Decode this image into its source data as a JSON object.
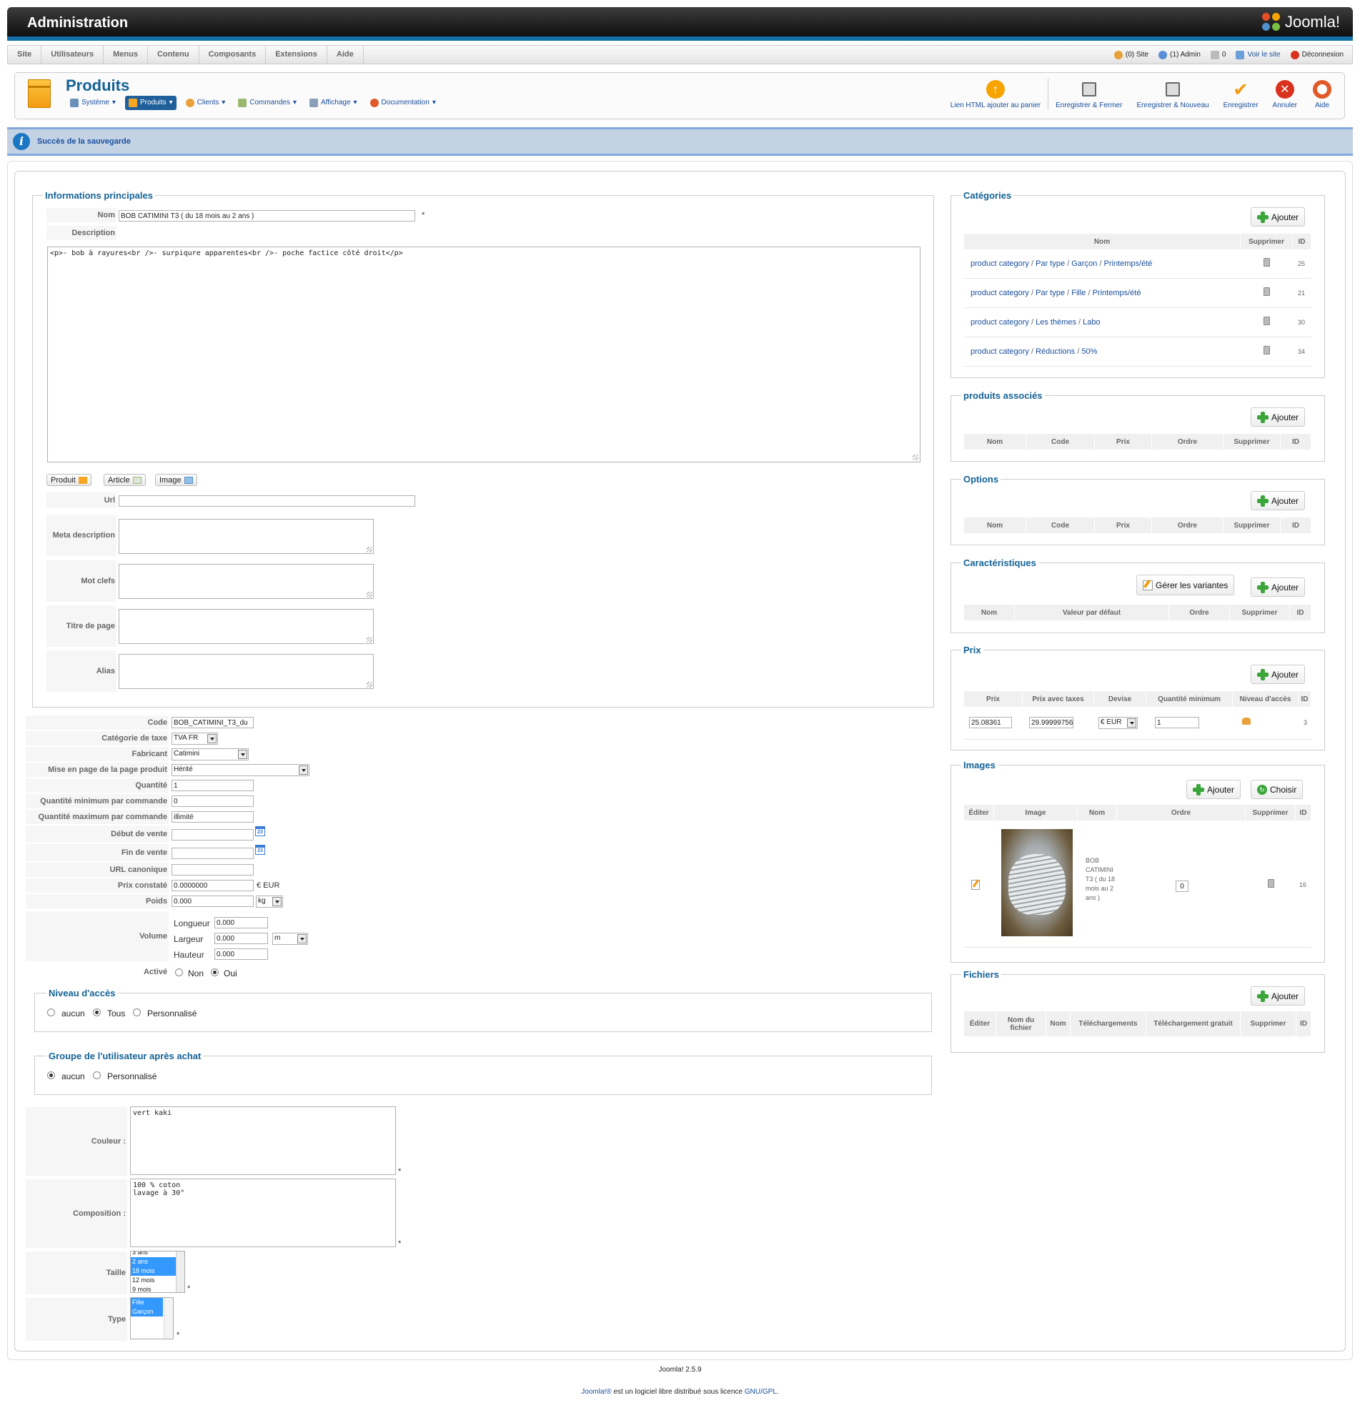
{
  "header": {
    "title": "Administration",
    "brand": "Joomla!"
  },
  "menu": [
    "Site",
    "Utilisateurs",
    "Menus",
    "Contenu",
    "Composants",
    "Extensions",
    "Aide"
  ],
  "status": {
    "site": "(0) Site",
    "admin": "(1) Admin",
    "messages": "0",
    "view_site": "Voir le site",
    "logout": "Déconnexion"
  },
  "toolbar": {
    "title": "Produits",
    "submenu": [
      "Système",
      "Produits",
      "Clients",
      "Commandes",
      "Affichage",
      "Documentation"
    ],
    "buttons": [
      "Lien HTML ajouter au panier",
      "Enregistrer & Fermer",
      "Enregistrer & Nouveau",
      "Enregistrer",
      "Annuler",
      "Aide"
    ]
  },
  "message": "Succès de la sauvegarde",
  "main": {
    "legend": "Informations principales",
    "name_label": "Nom",
    "name_value": "BOB CATIMINI T3 ( du 18 mois au 2 ans )",
    "required": "*",
    "description_label": "Description",
    "description_value": "<p>- bob à rayures<br />- surpiqure apparentes<br />- poche factice côté droit</p>",
    "editor_buttons": [
      "Produit",
      "Article",
      "Image"
    ],
    "url_label": "Url",
    "meta_desc_label": "Meta description",
    "keywords_label": "Mot clefs",
    "page_title_label": "Titre de page",
    "alias_label": "Alias"
  },
  "details": {
    "code_label": "Code",
    "code_value": "BOB_CATIMINI_T3_du",
    "tax_label": "Catégorie de taxe",
    "tax_value": "TVA FR",
    "manufacturer_label": "Fabricant",
    "manufacturer_value": "Catimini",
    "layout_label": "Mise en page de la page produit",
    "layout_value": "Hérité",
    "quantity_label": "Quantité",
    "quantity_value": "1",
    "min_qty_label": "Quantité minimum par commande",
    "min_qty_value": "0",
    "max_qty_label": "Quantité maximum par commande",
    "max_qty_value": "illimité",
    "start_label": "Début de vente",
    "end_label": "Fin de vente",
    "canonical_label": "URL canonique",
    "msrp_label": "Prix constaté",
    "msrp_value": "0.0000000",
    "msrp_currency": "€ EUR",
    "weight_label": "Poids",
    "weight_value": "0.000",
    "weight_unit": "kg",
    "volume_label": "Volume",
    "length_label": "Longueur",
    "length_value": "0.000",
    "width_label": "Largeur",
    "width_value": "0.000",
    "dim_unit": "m",
    "height_label": "Hauteur",
    "height_value": "0.000",
    "active_label": "Activé",
    "active_no": "Non",
    "active_yes": "Oui",
    "calendar_icon_text": "23"
  },
  "access": {
    "legend": "Niveau d'accès",
    "options": [
      "aucun",
      "Tous",
      "Personnalisé"
    ]
  },
  "group": {
    "legend": "Groupe de l'utilisateur après achat",
    "options": [
      "aucun",
      "Personnalisé"
    ]
  },
  "custom": {
    "color_label": "Couleur :",
    "color_value": "vert kaki",
    "composition_label": "Composition :",
    "composition_value": "100 % coton\nlavage à 30°",
    "size_label": "Taille",
    "size_options": [
      "3 ans",
      "2 ans",
      "18 mois",
      "12 mois",
      "9 mois"
    ],
    "type_label": "Type",
    "type_options": [
      "Fille",
      "Garçon"
    ]
  },
  "categories": {
    "legend": "Catégories",
    "add": "Ajouter",
    "headers": [
      "Nom",
      "Supprimer",
      "ID"
    ],
    "rows": [
      {
        "path": [
          "product category",
          "Par type",
          "Garçon",
          "Printemps/été"
        ],
        "id": "25"
      },
      {
        "path": [
          "product category",
          "Par type",
          "Fille",
          "Printemps/été"
        ],
        "id": "21"
      },
      {
        "path": [
          "product category",
          "Les thèmes",
          "Labo"
        ],
        "id": "30"
      },
      {
        "path": [
          "product category",
          "Réductions",
          "50%"
        ],
        "id": "34"
      }
    ],
    "sep": " / "
  },
  "related": {
    "legend": "produits associés",
    "add": "Ajouter",
    "headers": [
      "Nom",
      "Code",
      "Prix",
      "Ordre",
      "Supprimer",
      "ID"
    ]
  },
  "options": {
    "legend": "Options",
    "add": "Ajouter",
    "headers": [
      "Nom",
      "Code",
      "Prix",
      "Ordre",
      "Supprimer",
      "ID"
    ]
  },
  "characteristics": {
    "legend": "Caractéristiques",
    "variants": "Gérer les variantes",
    "add": "Ajouter",
    "headers": [
      "Nom",
      "Valeur par défaut",
      "Ordre",
      "Supprimer",
      "ID"
    ]
  },
  "prices": {
    "legend": "Prix",
    "add": "Ajouter",
    "headers": [
      "Prix",
      "Prix avec taxes",
      "Devise",
      "Quantité minimum",
      "Niveau d'accès",
      "ID"
    ],
    "row": {
      "price": "25.08361",
      "price_tax": "29.99999756",
      "currency": "€ EUR",
      "min_qty": "1",
      "id": "3"
    }
  },
  "images": {
    "legend": "Images",
    "add": "Ajouter",
    "choose": "Choisir",
    "headers": [
      "Éditer",
      "Image",
      "Nom",
      "Ordre",
      "Supprimer",
      "ID"
    ],
    "row": {
      "name": "BOB CATIMINI T3 ( du 18 mois au 2 ans )",
      "order": "0",
      "id": "16"
    }
  },
  "files": {
    "legend": "Fichiers",
    "add": "Ajouter",
    "headers": [
      "Éditer",
      "Nom du fichier",
      "Nom",
      "Téléchargements",
      "Téléchargement gratuit",
      "Supprimer",
      "ID"
    ]
  },
  "footer": {
    "version": "Joomla! 2.5.9",
    "license_brand": "Joomla!®",
    "license_text": " est un logiciel libre distribué sous licence ",
    "license_link": "GNU/GPL",
    "license_end": "."
  }
}
